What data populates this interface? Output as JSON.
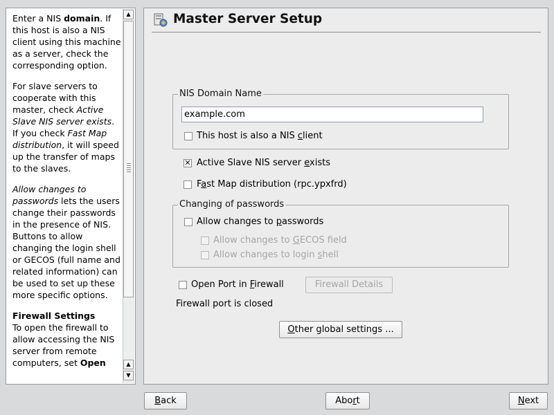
{
  "help": {
    "p1": {
      "t1": "Enter a NIS ",
      "b1": "domain",
      "t2": ". If this host is also a NIS client using this machine as a server, check the corresponding option."
    },
    "p2": {
      "t1": "For slave servers to cooperate with this master, check ",
      "i1": "Active Slave NIS server exists",
      "t2": ". If you check ",
      "i2": "Fast Map distribution",
      "t3": ", it will speed up the transfer of maps to the slaves."
    },
    "p3": {
      "i1": "Allow changes to passwords",
      "t1": " lets the users change their passwords in the presence of NIS. Buttons to allow changing the login shell or GECOS (full name and related information) can be used to set up these more specific options."
    },
    "p4": {
      "b1": "Firewall Settings",
      "t1": "To open the firewall to allow accessing the NIS server from remote computers, set ",
      "b2": "Open"
    },
    "scroll_up": "▲",
    "scroll_down": "▼"
  },
  "dialog": {
    "title": "Master Server Setup",
    "domain_group": {
      "legend": "NIS Domain Name",
      "domain_value": "example.com",
      "nis_client": {
        "pre": "This host is also a NIS ",
        "key": "c",
        "post": "lient",
        "checked": false
      }
    },
    "active_slave": {
      "pre": "Active Slave NIS server ",
      "key": "e",
      "post": "xists",
      "checked": true,
      "mark": "✕"
    },
    "fast_map": {
      "pre": "F",
      "key": "a",
      "post": "st Map distribution (rpc.ypxfrd)",
      "checked": false
    },
    "passwords_group": {
      "legend": "Changing of passwords",
      "allow_passwords": {
        "pre": "Allow changes to ",
        "key": "p",
        "post": "asswords",
        "checked": false
      },
      "allow_gecos": {
        "pre": "Allow changes to ",
        "key": "G",
        "post": "ECOS field",
        "checked": false,
        "disabled": true
      },
      "allow_shell": {
        "pre": "Allow changes to login ",
        "key": "s",
        "post": "hell",
        "checked": false,
        "disabled": true
      }
    },
    "firewall": {
      "open_port": {
        "pre": "Open Port in ",
        "key": "F",
        "post": "irewall",
        "checked": false
      },
      "details_button": "Firewall Details",
      "status": "Firewall port is closed"
    },
    "other_settings": {
      "key": "O",
      "post": "ther global settings ..."
    }
  },
  "footer": {
    "back": {
      "key": "B",
      "post": "ack"
    },
    "abort": {
      "pre": "Abo",
      "key": "r",
      "post": "t"
    },
    "next": {
      "key": "N",
      "post": "ext"
    }
  },
  "colors": {
    "background": "#d9dadb",
    "panel": "#ececec",
    "input_border": "#8a9bb3"
  }
}
